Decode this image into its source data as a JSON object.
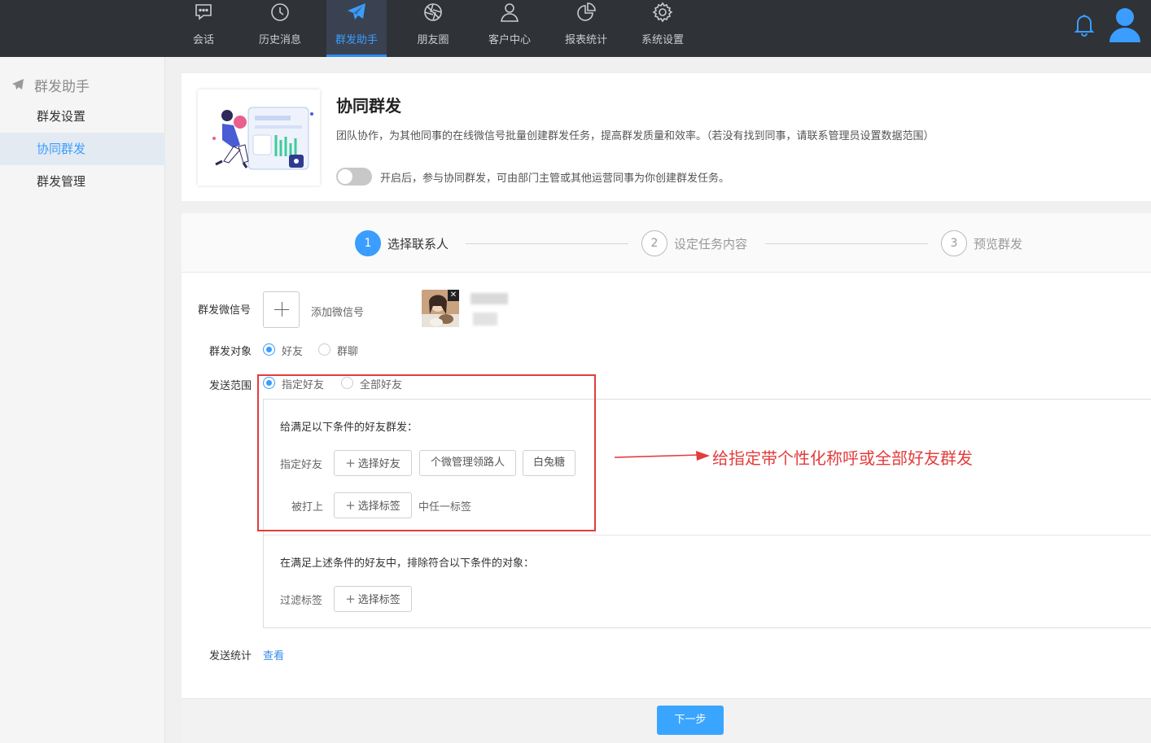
{
  "nav": {
    "items": [
      {
        "label": "会话",
        "icon": "chat-icon"
      },
      {
        "label": "历史消息",
        "icon": "clock-icon"
      },
      {
        "label": "群发助手",
        "icon": "paper-plane-icon",
        "active": true
      },
      {
        "label": "朋友圈",
        "icon": "aperture-icon"
      },
      {
        "label": "客户中心",
        "icon": "person-icon"
      },
      {
        "label": "报表统计",
        "icon": "pie-chart-icon"
      },
      {
        "label": "系统设置",
        "icon": "gear-icon"
      }
    ],
    "active_color": "#3a9dff"
  },
  "sidebar": {
    "heading": "群发助手",
    "items": [
      {
        "label": "群发设置"
      },
      {
        "label": "协同群发",
        "active": true
      },
      {
        "label": "群发管理"
      }
    ]
  },
  "header": {
    "title": "协同群发",
    "description": "团队协作，为其他同事的在线微信号批量创建群发任务，提高群发质量和效率。（若没有找到同事，请联系管理员设置数据范围）",
    "toggle_text": "开启后，参与协同群发，可由部门主管或其他运营同事为你创建群发任务。",
    "toggle_on": false
  },
  "steps": [
    {
      "num": "1",
      "label": "选择联系人",
      "active": true
    },
    {
      "num": "2",
      "label": "设定任务内容",
      "active": false
    },
    {
      "num": "3",
      "label": "预览群发",
      "active": false
    }
  ],
  "form": {
    "wechat_label": "群发微信号",
    "add_wechat": "添加微信号",
    "target_label": "群发对象",
    "target_options": [
      "好友",
      "群聊"
    ],
    "target_selected": "好友",
    "scope_label": "发送范围",
    "scope_options": [
      "指定好友",
      "全部好友"
    ],
    "scope_selected": "指定好友",
    "condition_title": "给满足以下条件的好友群发：",
    "specify_label": "指定好友",
    "select_friends": "选择好友",
    "friend_tags": [
      "个微管理领路人",
      "白兔糖"
    ],
    "tagged_label": "被打上",
    "select_tags": "选择标签",
    "any_tag": "中任一标签",
    "exclude_title": "在满足上述条件的好友中，排除符合以下条件的对象：",
    "filter_label": "过滤标签",
    "filter_select_tags": "选择标签",
    "stats_label": "发送统计",
    "stats_link": "查看"
  },
  "annotation": {
    "text": "给指定带个性化称呼或全部好友群发",
    "color": "#e33c3c"
  },
  "footer": {
    "next": "下一步"
  }
}
